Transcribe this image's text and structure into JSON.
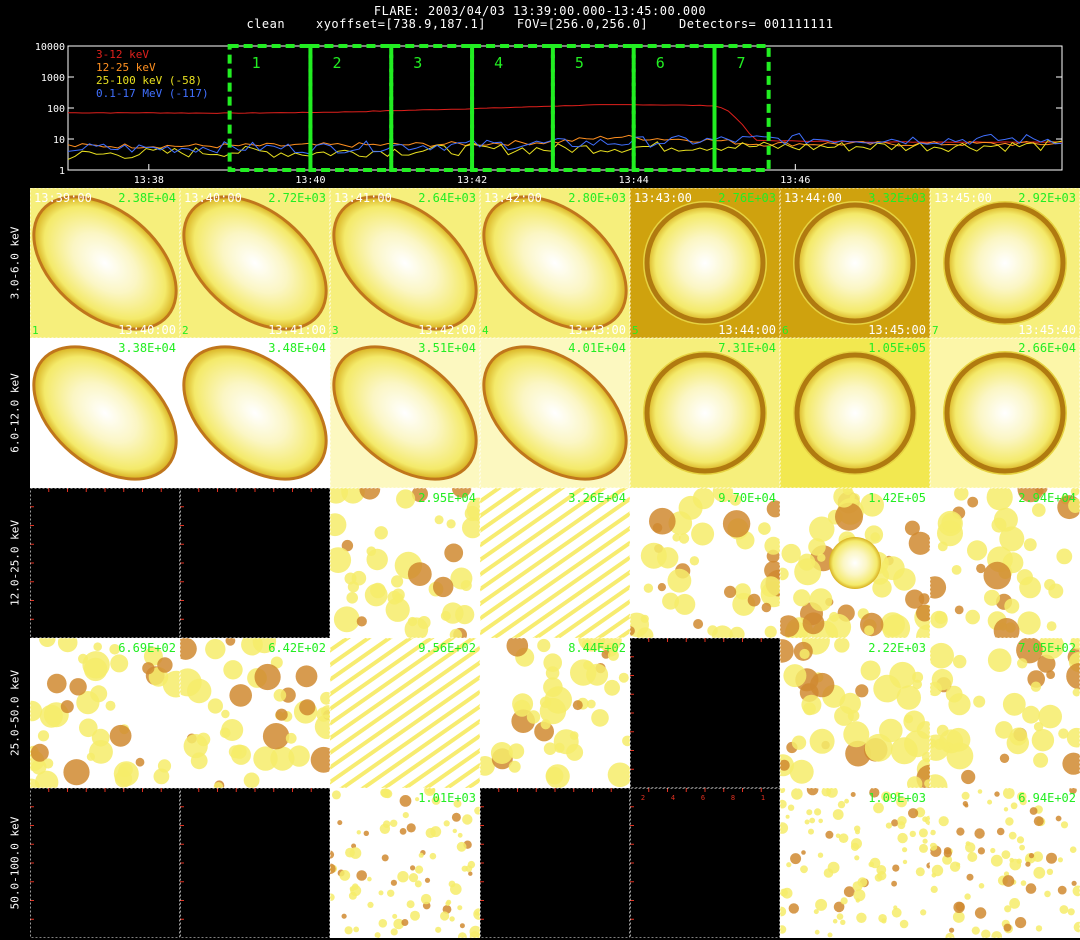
{
  "header": {
    "line1": "FLARE: 2003/04/03 13:39:00.000-13:45:00.000",
    "line2": "clean    xyoffset=[738.9,187.1]    FOV=[256.0,256.0]    Detectors= 001111111"
  },
  "chart_data": [
    {
      "type": "line",
      "yscale": "log",
      "ylim": [
        1,
        10000
      ],
      "y_tick_labels": [
        "1",
        "10",
        "100",
        "1000",
        "10000"
      ],
      "x_tick_labels": [
        "13:38",
        "13:40",
        "13:42",
        "13:44",
        "13:46"
      ],
      "xlim_minutes_after_1337": [
        0,
        12.3
      ],
      "x_tick_minutes_after_1337": [
        1,
        3,
        5,
        7,
        9
      ],
      "legend_position": "top-left",
      "series": [
        {
          "name": "3-12 keV",
          "color": "#e0201c",
          "x": [
            0,
            1,
            2,
            3,
            3.5,
            4,
            5,
            6,
            6.5,
            7,
            7.5,
            8,
            8.15,
            8.3,
            8.5,
            10,
            12.3
          ],
          "y": [
            70,
            70,
            68,
            72,
            75,
            82,
            95,
            115,
            125,
            128,
            125,
            118,
            90,
            40,
            9,
            8,
            8
          ]
        },
        {
          "name": "12-25 keV",
          "color": "#ff9020",
          "x": [
            0,
            2,
            4,
            5,
            6,
            6.8,
            7,
            8,
            8.5,
            10,
            12.3
          ],
          "y": [
            6,
            6,
            6.5,
            7,
            8,
            12,
            11,
            9,
            7,
            7,
            7
          ]
        },
        {
          "name": "25-100 keV (-58)",
          "color": "#e8e020",
          "x": [
            0,
            1,
            2,
            3,
            4,
            5,
            6,
            7,
            8,
            9,
            10,
            11,
            12.3
          ],
          "y": [
            3,
            3.5,
            4,
            3.5,
            4.2,
            4.5,
            4.8,
            5.5,
            6,
            5.5,
            5.8,
            6,
            6
          ]
        },
        {
          "name": "0.1-17 MeV (-117)",
          "color": "#4070ff",
          "x": [
            0,
            1,
            2,
            3,
            4,
            5,
            6,
            7,
            8,
            9,
            10,
            11,
            12.3
          ],
          "y": [
            5,
            5,
            5.5,
            5,
            6,
            6.5,
            7,
            8,
            9,
            10,
            10,
            9.5,
            10
          ]
        }
      ],
      "intervals": [
        {
          "label": "1",
          "start_min": 2.0,
          "end_min": 3.0
        },
        {
          "label": "2",
          "start_min": 3.0,
          "end_min": 4.0
        },
        {
          "label": "3",
          "start_min": 4.0,
          "end_min": 5.0
        },
        {
          "label": "4",
          "start_min": 5.0,
          "end_min": 6.0
        },
        {
          "label": "5",
          "start_min": 6.0,
          "end_min": 7.0
        },
        {
          "label": "6",
          "start_min": 7.0,
          "end_min": 8.0
        },
        {
          "label": "7",
          "start_min": 8.0,
          "end_min": 8.67
        }
      ],
      "interval_color": "#22ee22"
    },
    {
      "type": "heatmap",
      "energy_bands": [
        "3.0-6.0 keV",
        "6.0-12.0 keV",
        "12.0-25.0 keV",
        "25.0-50.0 keV",
        "50.0-100.0 keV"
      ],
      "columns": 7,
      "rows": [
        [
          {
            "max": "2.38E+04",
            "start": "13:39:00",
            "num": "1",
            "end": "13:40:00",
            "morph": "ellipse",
            "bg": "#f6ef7c"
          },
          {
            "max": "2.72E+03",
            "start": "13:40:00",
            "num": "2",
            "end": "13:41:00",
            "morph": "ellipse",
            "bg": "#f6ef7c"
          },
          {
            "max": "2.64E+03",
            "start": "13:41:00",
            "num": "3",
            "end": "13:42:00",
            "morph": "ellipse",
            "bg": "#f6ef7c"
          },
          {
            "max": "2.80E+03",
            "start": "13:42:00",
            "num": "4",
            "end": "13:43:00",
            "morph": "ellipse",
            "bg": "#f6ef7c"
          },
          {
            "max": "2.76E+03",
            "start": "13:43:00",
            "num": "5",
            "end": "13:44:00",
            "morph": "ring",
            "bg": "#cfa20e"
          },
          {
            "max": "3.32E+03",
            "start": "13:44:00",
            "num": "6",
            "end": "13:45:00",
            "morph": "ring",
            "bg": "#cfa20e"
          },
          {
            "max": "2.92E+03",
            "start": "13:45:00",
            "num": "7",
            "end": "13:45:40",
            "morph": "ring",
            "bg": "#f6ef7c"
          }
        ],
        [
          {
            "max": "3.38E+04",
            "morph": "ellipse",
            "bg": "#ffffff"
          },
          {
            "max": "3.48E+04",
            "morph": "ellipse",
            "bg": "#ffffff"
          },
          {
            "max": "3.51E+04",
            "morph": "ellipse",
            "bg": "#fcf8c0"
          },
          {
            "max": "4.01E+04",
            "morph": "ellipse",
            "bg": "#fcf8c0"
          },
          {
            "max": "7.31E+04",
            "morph": "ring",
            "bg": "#f6ef7c"
          },
          {
            "max": "1.05E+05",
            "morph": "ring",
            "bg": "#f2e850"
          },
          {
            "max": "2.66E+04",
            "morph": "ring",
            "bg": "#fcf6a8"
          }
        ],
        [
          {
            "max": "",
            "morph": "none"
          },
          {
            "max": "",
            "morph": "none"
          },
          {
            "max": "2.95E+04",
            "morph": "noise",
            "bg": "#ffffff"
          },
          {
            "max": "3.26E+04",
            "morph": "stripes",
            "bg": "#ffffff"
          },
          {
            "max": "9.70E+04",
            "morph": "noise",
            "bg": "#ffffff"
          },
          {
            "max": "1.42E+05",
            "morph": "blob",
            "bg": "#ffffff"
          },
          {
            "max": "2.94E+04",
            "morph": "noise",
            "bg": "#ffffff"
          }
        ],
        [
          {
            "max": "6.69E+02",
            "morph": "noise",
            "bg": "#ffffff"
          },
          {
            "max": "6.42E+02",
            "morph": "noise",
            "bg": "#ffffff"
          },
          {
            "max": "9.56E+02",
            "morph": "stripes",
            "bg": "#ffffff"
          },
          {
            "max": "8.44E+02",
            "morph": "noise",
            "bg": "#ffffff"
          },
          {
            "max": "",
            "morph": "none"
          },
          {
            "max": "2.22E+03",
            "morph": "noise",
            "bg": "#ffffff"
          },
          {
            "max": "7.05E+02",
            "morph": "noise",
            "bg": "#ffffff"
          }
        ],
        [
          {
            "max": "",
            "morph": "none"
          },
          {
            "max": "",
            "morph": "none"
          },
          {
            "max": "1.01E+03",
            "morph": "dense",
            "bg": "#ffffff"
          },
          {
            "max": "",
            "morph": "none"
          },
          {
            "max": "",
            "morph": "none",
            "axis_ticks": [
              "2",
              "4",
              "6",
              "8",
              "1"
            ]
          },
          {
            "max": "1.09E+03",
            "morph": "dense",
            "bg": "#ffffff"
          },
          {
            "max": "6.94E+02",
            "morph": "dense",
            "bg": "#ffffff"
          }
        ]
      ],
      "colors": {
        "text": "#22ee22",
        "info": "#ffffff",
        "empty_tick": "#e03020"
      }
    }
  ]
}
